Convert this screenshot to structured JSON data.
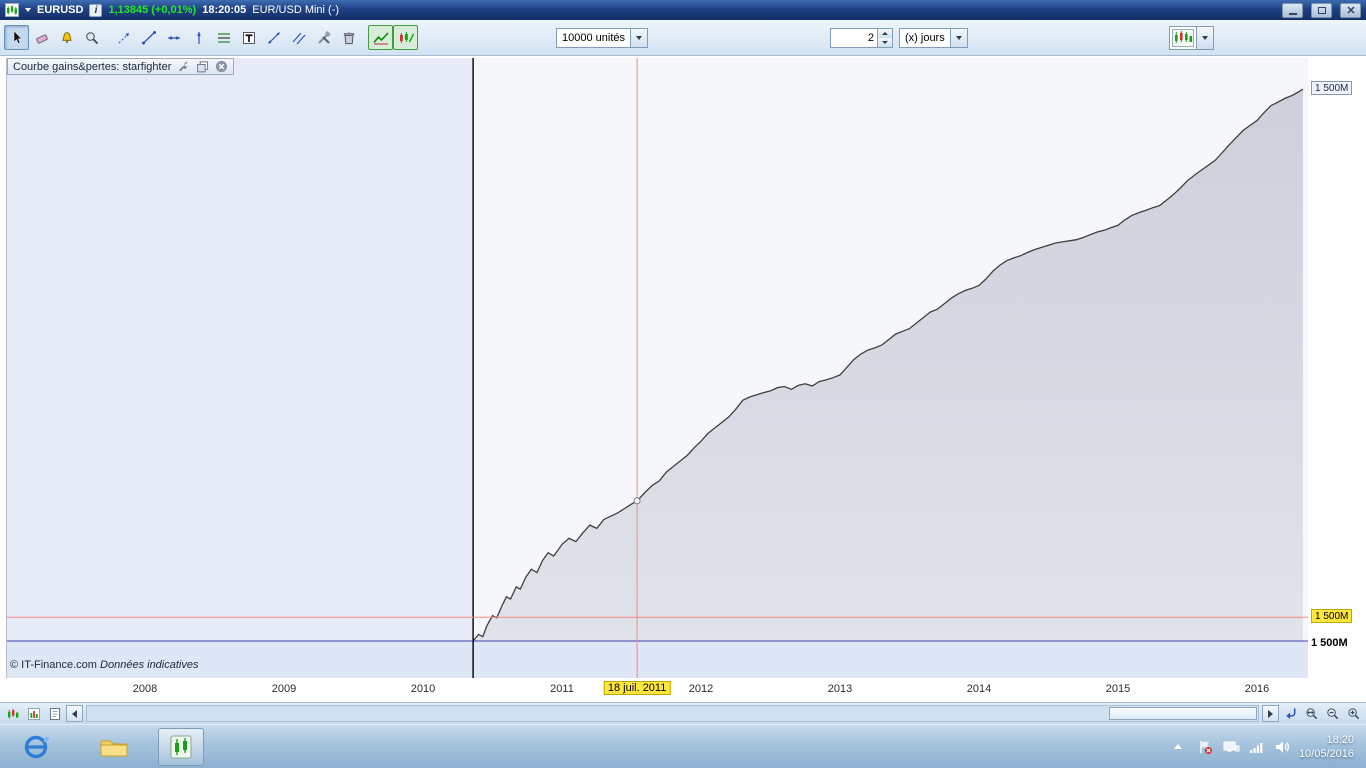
{
  "titlebar": {
    "symbol": "EURUSD",
    "info": "i",
    "price": "1,13845 (+0,01%)",
    "time": "18:20:05",
    "instrument": "EUR/USD Mini (-)"
  },
  "toolbar": {
    "units_value": "10000 unités",
    "period_count": "2",
    "timeframe_value": "(x) jours",
    "icons": [
      "pointer",
      "eraser",
      "alarm",
      "zoom",
      "arrow-draw",
      "segment",
      "horizontal-line",
      "vertical-line",
      "fibonacci",
      "text",
      "extended-line",
      "parallel-lines",
      "drawing-tools",
      "trash",
      "line-chart-mode",
      "pattern-mode",
      "chart-style-preview"
    ]
  },
  "panel": {
    "title": "Courbe gains&pertes: starfighter"
  },
  "chart_data": {
    "type": "area",
    "title": "Courbe gains&pertes: starfighter",
    "x_ticks": [
      {
        "year": 2008,
        "label": "2008"
      },
      {
        "year": 2009,
        "label": "2009"
      },
      {
        "year": 2010,
        "label": "2010"
      },
      {
        "year": 2011,
        "label": "2011"
      },
      {
        "year": 2012,
        "label": "2012"
      },
      {
        "year": 2013,
        "label": "2013"
      },
      {
        "year": 2014,
        "label": "2014"
      },
      {
        "year": 2015,
        "label": "2015"
      },
      {
        "year": 2016,
        "label": "2016"
      }
    ],
    "x_range_years": [
      2007.0,
      2016.37
    ],
    "y_axis": {
      "baseline_value": 0,
      "top_value": 100,
      "unit": "M",
      "grid": false
    },
    "start_marker_year": 2010.36,
    "labels": {
      "current_value": "1 500M",
      "crosshair_value": "1 500M",
      "baseline": "1 500M",
      "crosshair_date": "18 juil. 2011"
    },
    "crosshair": {
      "x_year": 2011.54,
      "y_value": 4.3,
      "point_value": 25.4
    },
    "series": [
      {
        "name": "starfighter-equity",
        "points": [
          [
            2010.36,
            0
          ],
          [
            2010.4,
            1.2
          ],
          [
            2010.43,
            0.8
          ],
          [
            2010.46,
            2.8
          ],
          [
            2010.5,
            4.6
          ],
          [
            2010.53,
            4.2
          ],
          [
            2010.57,
            6.5
          ],
          [
            2010.6,
            8.0
          ],
          [
            2010.63,
            7.6
          ],
          [
            2010.67,
            9.8
          ],
          [
            2010.7,
            9.4
          ],
          [
            2010.74,
            11.6
          ],
          [
            2010.78,
            13.0
          ],
          [
            2010.82,
            12.4
          ],
          [
            2010.86,
            14.6
          ],
          [
            2010.9,
            16.0
          ],
          [
            2010.94,
            15.4
          ],
          [
            2011.0,
            17.5
          ],
          [
            2011.05,
            18.6
          ],
          [
            2011.1,
            18.0
          ],
          [
            2011.15,
            19.6
          ],
          [
            2011.2,
            21.0
          ],
          [
            2011.25,
            20.4
          ],
          [
            2011.3,
            22.0
          ],
          [
            2011.35,
            22.6
          ],
          [
            2011.4,
            23.2
          ],
          [
            2011.45,
            24.0
          ],
          [
            2011.5,
            24.8
          ],
          [
            2011.54,
            25.4
          ],
          [
            2011.6,
            27.0
          ],
          [
            2011.65,
            28.2
          ],
          [
            2011.7,
            29.0
          ],
          [
            2011.75,
            30.6
          ],
          [
            2011.8,
            31.6
          ],
          [
            2011.85,
            32.6
          ],
          [
            2011.9,
            33.6
          ],
          [
            2011.95,
            35.0
          ],
          [
            2012.0,
            36.2
          ],
          [
            2012.05,
            37.6
          ],
          [
            2012.1,
            38.6
          ],
          [
            2012.15,
            39.6
          ],
          [
            2012.2,
            40.6
          ],
          [
            2012.25,
            42.0
          ],
          [
            2012.3,
            43.6
          ],
          [
            2012.35,
            44.2
          ],
          [
            2012.4,
            44.6
          ],
          [
            2012.45,
            45.0
          ],
          [
            2012.5,
            45.3
          ],
          [
            2012.55,
            45.9
          ],
          [
            2012.6,
            46.1
          ],
          [
            2012.65,
            45.6
          ],
          [
            2012.7,
            46.3
          ],
          [
            2012.75,
            46.6
          ],
          [
            2012.8,
            46.2
          ],
          [
            2012.85,
            47.0
          ],
          [
            2012.9,
            47.3
          ],
          [
            2012.95,
            47.7
          ],
          [
            2013.0,
            48.2
          ],
          [
            2013.05,
            49.6
          ],
          [
            2013.1,
            51.0
          ],
          [
            2013.15,
            52.0
          ],
          [
            2013.2,
            52.7
          ],
          [
            2013.25,
            53.1
          ],
          [
            2013.3,
            53.6
          ],
          [
            2013.35,
            54.6
          ],
          [
            2013.4,
            55.6
          ],
          [
            2013.45,
            56.1
          ],
          [
            2013.5,
            56.6
          ],
          [
            2013.55,
            57.6
          ],
          [
            2013.6,
            58.6
          ],
          [
            2013.65,
            59.6
          ],
          [
            2013.7,
            60.1
          ],
          [
            2013.75,
            61.1
          ],
          [
            2013.8,
            62.1
          ],
          [
            2013.85,
            62.9
          ],
          [
            2013.9,
            63.5
          ],
          [
            2013.95,
            63.9
          ],
          [
            2014.0,
            64.4
          ],
          [
            2014.05,
            65.6
          ],
          [
            2014.1,
            67.0
          ],
          [
            2014.15,
            68.1
          ],
          [
            2014.2,
            68.9
          ],
          [
            2014.25,
            69.4
          ],
          [
            2014.3,
            69.8
          ],
          [
            2014.35,
            70.4
          ],
          [
            2014.4,
            70.9
          ],
          [
            2014.45,
            71.3
          ],
          [
            2014.5,
            71.7
          ],
          [
            2014.55,
            72.1
          ],
          [
            2014.6,
            72.3
          ],
          [
            2014.65,
            72.5
          ],
          [
            2014.7,
            72.7
          ],
          [
            2014.75,
            73.1
          ],
          [
            2014.8,
            73.6
          ],
          [
            2014.85,
            74.1
          ],
          [
            2014.9,
            74.4
          ],
          [
            2014.95,
            74.9
          ],
          [
            2015.0,
            75.3
          ],
          [
            2015.05,
            76.3
          ],
          [
            2015.1,
            77.1
          ],
          [
            2015.15,
            77.6
          ],
          [
            2015.2,
            78.0
          ],
          [
            2015.25,
            78.5
          ],
          [
            2015.3,
            78.9
          ],
          [
            2015.35,
            79.9
          ],
          [
            2015.4,
            80.9
          ],
          [
            2015.45,
            82.1
          ],
          [
            2015.5,
            83.4
          ],
          [
            2015.55,
            84.4
          ],
          [
            2015.6,
            85.3
          ],
          [
            2015.65,
            86.2
          ],
          [
            2015.7,
            87.1
          ],
          [
            2015.75,
            88.5
          ],
          [
            2015.8,
            89.9
          ],
          [
            2015.85,
            91.2
          ],
          [
            2015.9,
            92.5
          ],
          [
            2015.95,
            93.4
          ],
          [
            2016.0,
            94.3
          ],
          [
            2016.05,
            95.7
          ],
          [
            2016.1,
            97.0
          ],
          [
            2016.15,
            97.6
          ],
          [
            2016.2,
            98.3
          ],
          [
            2016.25,
            98.8
          ],
          [
            2016.3,
            99.5
          ],
          [
            2016.33,
            100
          ]
        ]
      }
    ]
  },
  "footer": {
    "copyright": "© IT-Finance.com",
    "note": "Données indicatives"
  },
  "tray": {
    "time": "18:20",
    "date": "10/05/2016",
    "icons": [
      "hidden-icons",
      "action-center-flag",
      "network",
      "signal",
      "volume"
    ]
  },
  "colors": {
    "price_green": "#25e625",
    "crosshair_pink": "#f08a8a",
    "baseline_blue": "#3a42b4",
    "highlight_yellow": "#ffe63c"
  }
}
